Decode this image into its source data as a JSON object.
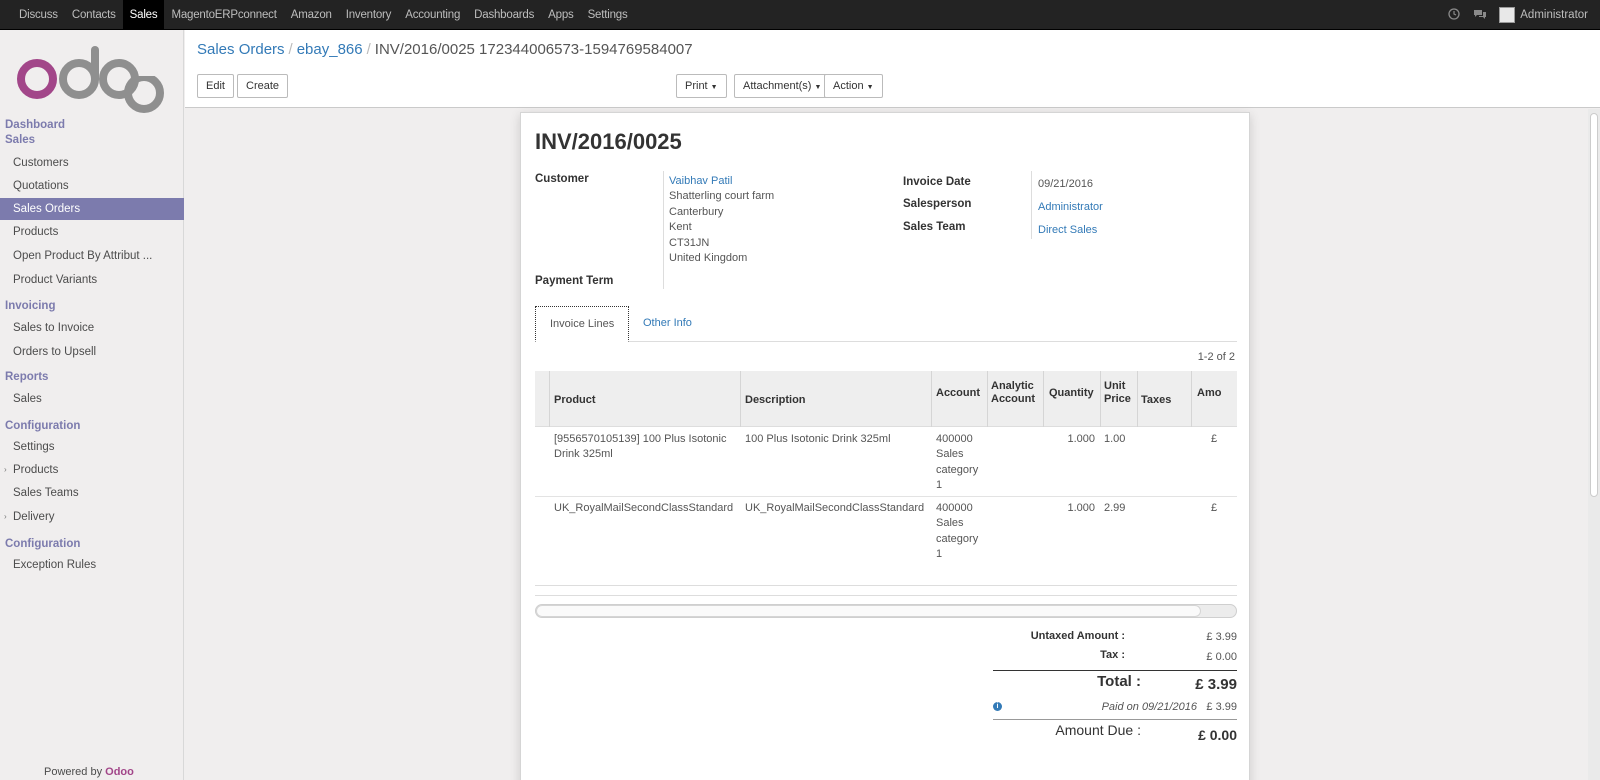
{
  "topbar": {
    "menu": [
      "Discuss",
      "Contacts",
      "Sales",
      "MagentoERPconnect",
      "Amazon",
      "Inventory",
      "Accounting",
      "Dashboards",
      "Apps",
      "Settings"
    ],
    "active": "Sales",
    "user": "Administrator"
  },
  "sidebar": {
    "dashboard": "Dashboard",
    "sales_head": "Sales",
    "sales_items": [
      "Customers",
      "Quotations",
      "Sales Orders",
      "Products",
      "Open Product By Attribut ...",
      "Product Variants"
    ],
    "invoicing_head": "Invoicing",
    "invoicing_items": [
      "Sales to Invoice",
      "Orders to Upsell"
    ],
    "reports_head": "Reports",
    "reports_items": [
      "Sales"
    ],
    "configuration_head": "Configuration",
    "configuration_items": [
      "Settings",
      "Products",
      "Sales Teams",
      "Delivery"
    ],
    "configuration2_head": "Configuration",
    "configuration2_items": [
      "Exception Rules"
    ],
    "powered_by": "Powered by",
    "powered_brand": "Odoo"
  },
  "breadcrumb": {
    "root": "Sales Orders",
    "parent": "ebay_866",
    "current": "INV/2016/0025 172344006573-1594769584007"
  },
  "buttons": {
    "edit": "Edit",
    "create": "Create",
    "print": "Print",
    "attachments": "Attachment(s)",
    "action": "Action"
  },
  "invoice": {
    "number": "INV/2016/0025",
    "customer_label": "Customer",
    "customer_name": "Vaibhav Patil",
    "customer_address": [
      "Shatterling court farm",
      "Canterbury",
      "Kent",
      "CT31JN",
      "United Kingdom"
    ],
    "payment_term_label": "Payment Term",
    "invoice_date_label": "Invoice Date",
    "invoice_date": "09/21/2016",
    "salesperson_label": "Salesperson",
    "salesperson": "Administrator",
    "sales_team_label": "Sales Team",
    "sales_team": "Direct Sales"
  },
  "tabs": [
    "Invoice Lines",
    "Other Info"
  ],
  "pager": "1-2 of 2",
  "lines": {
    "headers": {
      "product": "Product",
      "description": "Description",
      "account": "Account",
      "analytic_1": "Analytic",
      "analytic_2": "Account",
      "quantity": "Quantity",
      "unit_1": "Unit",
      "unit_2": "Price",
      "taxes": "Taxes",
      "amount": "Amo"
    },
    "rows": [
      {
        "product_1": "[9556570105139] 100 Plus Isotonic",
        "product_2": "Drink 325ml",
        "description": "100 Plus Isotonic Drink 325ml",
        "account": [
          "400000",
          "Sales",
          "category",
          "1"
        ],
        "quantity": "1.000",
        "unit_price": "1.00",
        "amount": "£"
      },
      {
        "product_1": "UK_RoyalMailSecondClassStandard",
        "product_2": "",
        "description": "UK_RoyalMailSecondClassStandard",
        "account": [
          "400000",
          "Sales",
          "category",
          "1"
        ],
        "quantity": "1.000",
        "unit_price": "2.99",
        "amount": "£"
      }
    ]
  },
  "totals": {
    "untaxed_label": "Untaxed Amount :",
    "untaxed": "£ 3.99",
    "tax_label": "Tax :",
    "tax": "£ 0.00",
    "total_label": "Total :",
    "total": "£ 3.99",
    "paid_label": "Paid on 09/21/2016",
    "paid": "£ 3.99",
    "due_label": "Amount Due :",
    "due": "£ 0.00"
  },
  "colors": {
    "brand": "#7c7bad",
    "link": "#337ab7",
    "odoo_logo": "#a24689"
  }
}
